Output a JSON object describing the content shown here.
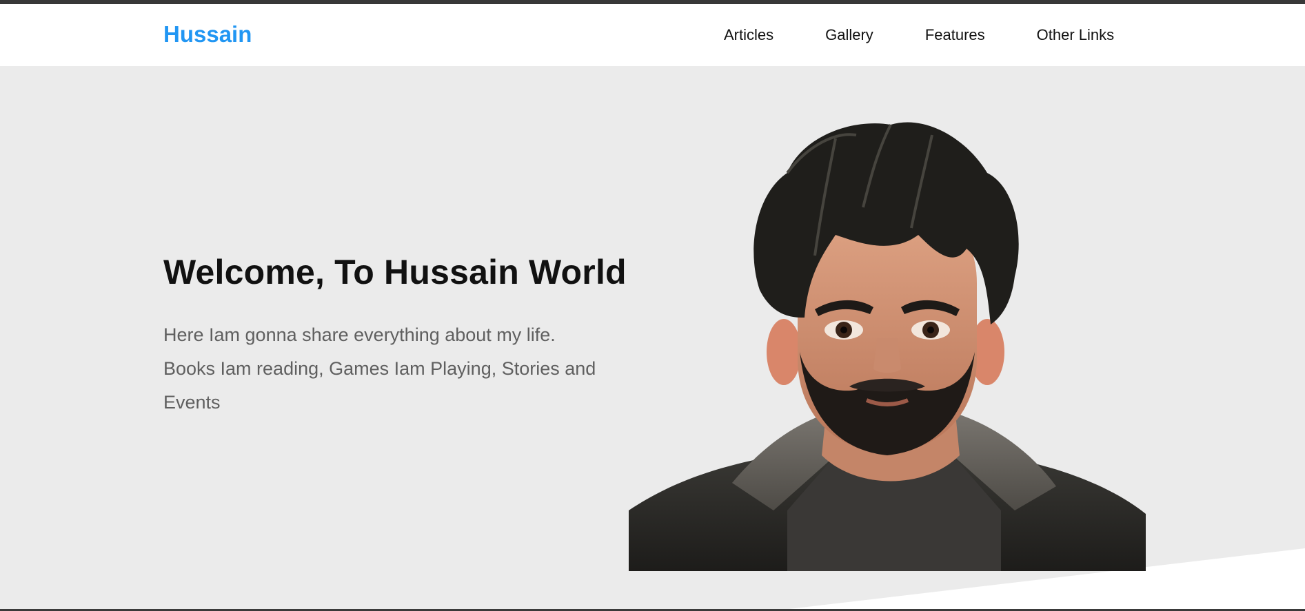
{
  "header": {
    "logo": "Hussain",
    "nav": [
      "Articles",
      "Gallery",
      "Features",
      "Other Links"
    ]
  },
  "hero": {
    "title": "Welcome, To Hussain World",
    "description": "Here Iam gonna share everything about my life. Books Iam reading, Games Iam Playing, Stories and Events",
    "image": "portrait-illustration"
  },
  "colors": {
    "brand": "#2196f3",
    "background": "#ebebeb",
    "header_bg": "#ffffff",
    "top_strip": "#383838",
    "title_text": "#111111",
    "body_text": "#5f5f5f"
  }
}
